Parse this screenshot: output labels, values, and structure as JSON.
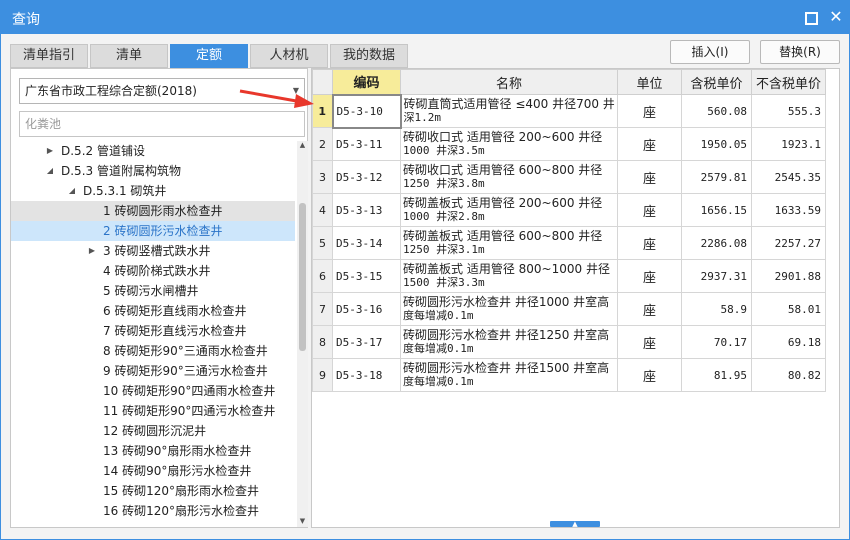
{
  "window": {
    "title": "查询"
  },
  "tabs": [
    {
      "label": "清单指引",
      "active": false
    },
    {
      "label": "清单",
      "active": false
    },
    {
      "label": "定额",
      "active": true
    },
    {
      "label": "人材机",
      "active": false
    },
    {
      "label": "我的数据",
      "active": false
    }
  ],
  "actions": {
    "insert_label": "插入(I)",
    "replace_label": "替换(R)"
  },
  "left": {
    "library_selected": "广东省市政工程综合定额(2018)",
    "search_placeholder": "化粪池",
    "tree": [
      {
        "label": "D.5.2 管道铺设",
        "toggle": "▶",
        "state": ""
      },
      {
        "label": "D.5.3 管道附属构筑物",
        "toggle": "◢",
        "state": ""
      },
      {
        "label": "D.5.3.1 砌筑井",
        "toggle": "◢",
        "state": ""
      },
      {
        "label": "1 砖砌圆形雨水检查井",
        "toggle": "",
        "state": "selected"
      },
      {
        "label": "2 砖砌圆形污水检查井",
        "toggle": "",
        "state": "hover"
      },
      {
        "label": "3 砖砌竖槽式跌水井",
        "toggle": "▶",
        "state": ""
      },
      {
        "label": "4 砖砌阶梯式跌水井",
        "toggle": "",
        "state": ""
      },
      {
        "label": "5 砖砌污水闸槽井",
        "toggle": "",
        "state": ""
      },
      {
        "label": "6 砖砌矩形直线雨水检查井",
        "toggle": "",
        "state": ""
      },
      {
        "label": "7 砖砌矩形直线污水检查井",
        "toggle": "",
        "state": ""
      },
      {
        "label": "8 砖砌矩形90°三通雨水检查井",
        "toggle": "",
        "state": ""
      },
      {
        "label": "9 砖砌矩形90°三通污水检查井",
        "toggle": "",
        "state": ""
      },
      {
        "label": "10 砖砌矩形90°四通雨水检查井",
        "toggle": "",
        "state": ""
      },
      {
        "label": "11 砖砌矩形90°四通污水检查井",
        "toggle": "",
        "state": ""
      },
      {
        "label": "12 砖砌圆形沉泥井",
        "toggle": "",
        "state": ""
      },
      {
        "label": "13 砖砌90°扇形雨水检查井",
        "toggle": "",
        "state": ""
      },
      {
        "label": "14 砖砌90°扇形污水检查井",
        "toggle": "",
        "state": ""
      },
      {
        "label": "15 砖砌120°扇形雨水检查井",
        "toggle": "",
        "state": ""
      },
      {
        "label": "16 砖砌120°扇形污水检查井",
        "toggle": "",
        "state": ""
      }
    ]
  },
  "grid": {
    "headers": {
      "no": "",
      "code": "编码",
      "name": "名称",
      "unit": "单位",
      "tax_price": "含税单价",
      "notax_price": "不含税单价"
    },
    "rows": [
      {
        "no": "1",
        "code": "D5-3-10",
        "name_line1": "砖砌直筒式适用管径 ≤400 井径700 井",
        "name_line2": "深1.2m",
        "unit": "座",
        "tax_price": "560.08",
        "notax_price": "555.3"
      },
      {
        "no": "2",
        "code": "D5-3-11",
        "name_line1": "砖砌收口式 适用管径 200~600 井径",
        "name_line2": "1000 井深3.5m",
        "unit": "座",
        "tax_price": "1950.05",
        "notax_price": "1923.1"
      },
      {
        "no": "3",
        "code": "D5-3-12",
        "name_line1": "砖砌收口式 适用管径 600~800 井径",
        "name_line2": "1250 井深3.8m",
        "unit": "座",
        "tax_price": "2579.81",
        "notax_price": "2545.35"
      },
      {
        "no": "4",
        "code": "D5-3-13",
        "name_line1": "砖砌盖板式 适用管径 200~600 井径",
        "name_line2": "1000 井深2.8m",
        "unit": "座",
        "tax_price": "1656.15",
        "notax_price": "1633.59"
      },
      {
        "no": "5",
        "code": "D5-3-14",
        "name_line1": "砖砌盖板式 适用管径 600~800 井径",
        "name_line2": "1250 井深3.1m",
        "unit": "座",
        "tax_price": "2286.08",
        "notax_price": "2257.27"
      },
      {
        "no": "6",
        "code": "D5-3-15",
        "name_line1": "砖砌盖板式 适用管径 800~1000 井径",
        "name_line2": "1500 井深3.3m",
        "unit": "座",
        "tax_price": "2937.31",
        "notax_price": "2901.88"
      },
      {
        "no": "7",
        "code": "D5-3-16",
        "name_line1": "砖砌圆形污水检查井 井径1000 井室高",
        "name_line2": "度每增减0.1m",
        "unit": "座",
        "tax_price": "58.9",
        "notax_price": "58.01"
      },
      {
        "no": "8",
        "code": "D5-3-17",
        "name_line1": "砖砌圆形污水检查井 井径1250 井室高",
        "name_line2": "度每增减0.1m",
        "unit": "座",
        "tax_price": "70.17",
        "notax_price": "69.18"
      },
      {
        "no": "9",
        "code": "D5-3-18",
        "name_line1": "砖砌圆形污水检查井 井径1500 井室高",
        "name_line2": "度每增减0.1m",
        "unit": "座",
        "tax_price": "81.95",
        "notax_price": "80.82"
      }
    ]
  },
  "colors": {
    "accent": "#3d8fe0",
    "current_cell": "#f7ec9a",
    "hover_row": "#cde6fb",
    "arrow": "#e8372b"
  }
}
